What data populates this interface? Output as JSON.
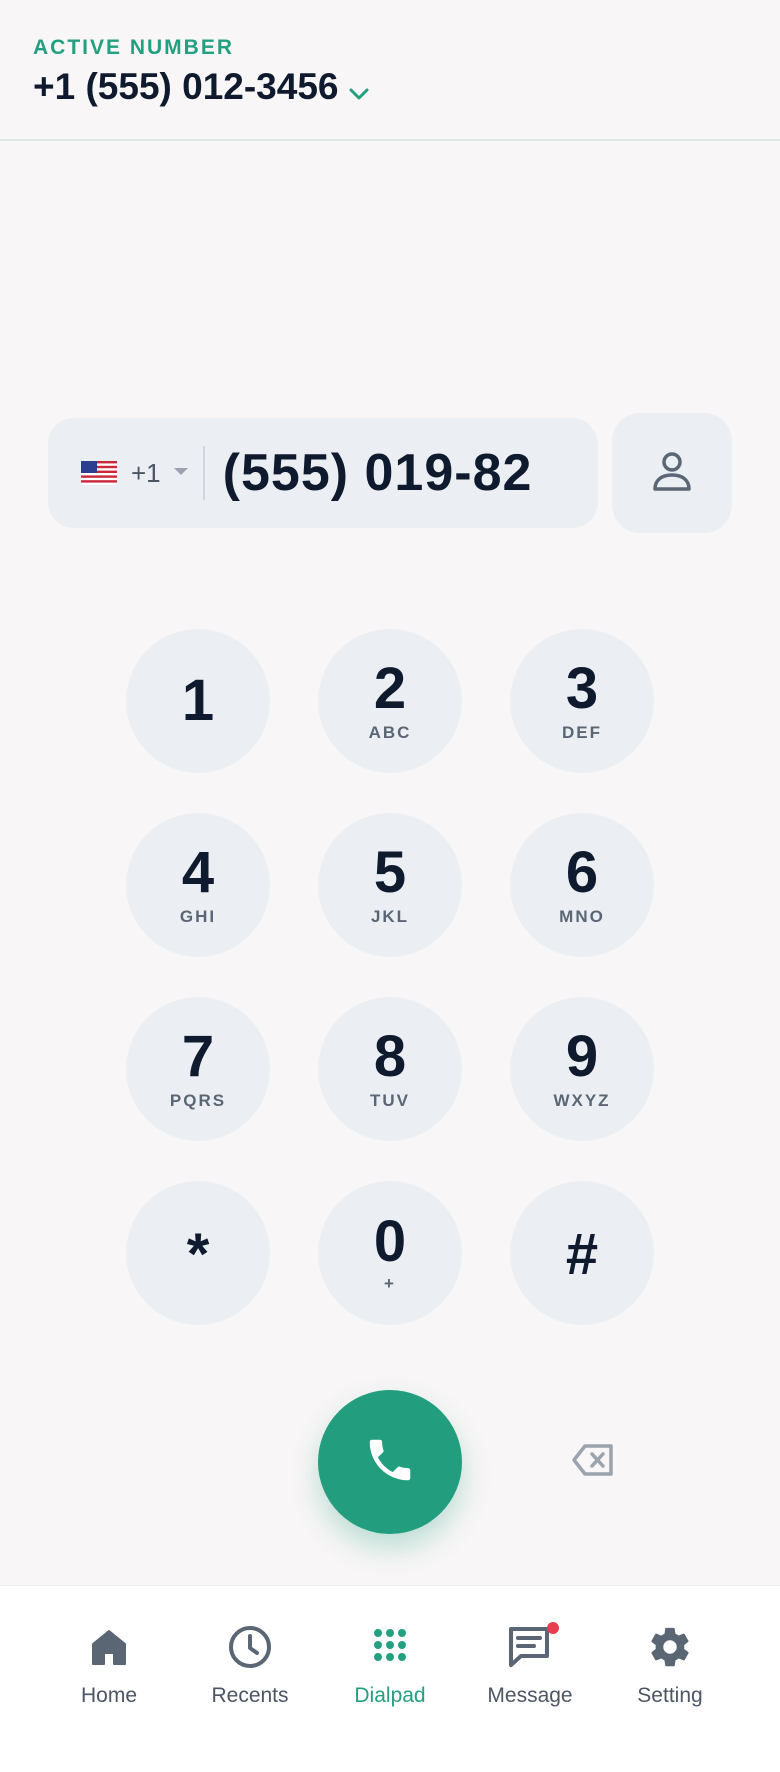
{
  "header": {
    "active_label": "ACTIVE NUMBER",
    "active_number": "+1 (555) 012-3456"
  },
  "dial_input": {
    "country_code": "+1",
    "flag": "us-flag-icon",
    "value": "(555) 019-82"
  },
  "keypad": [
    {
      "digit": "1",
      "letters": ""
    },
    {
      "digit": "2",
      "letters": "ABC"
    },
    {
      "digit": "3",
      "letters": "DEF"
    },
    {
      "digit": "4",
      "letters": "GHI"
    },
    {
      "digit": "5",
      "letters": "JKL"
    },
    {
      "digit": "6",
      "letters": "MNO"
    },
    {
      "digit": "7",
      "letters": "PQRS"
    },
    {
      "digit": "8",
      "letters": "TUV"
    },
    {
      "digit": "9",
      "letters": "WXYZ"
    },
    {
      "digit": "*",
      "letters": ""
    },
    {
      "digit": "0",
      "letters": "+"
    },
    {
      "digit": "#",
      "letters": ""
    }
  ],
  "nav": {
    "items": [
      {
        "label": "Home",
        "icon": "home-icon"
      },
      {
        "label": "Recents",
        "icon": "clock-icon"
      },
      {
        "label": "Dialpad",
        "icon": "dialpad-icon",
        "active": true
      },
      {
        "label": "Message",
        "icon": "message-icon",
        "badge": true
      },
      {
        "label": "Setting",
        "icon": "gear-icon"
      }
    ]
  },
  "colors": {
    "accent": "#22a07f",
    "key_bg": "#ebeff4",
    "badge": "#e53e4f"
  }
}
